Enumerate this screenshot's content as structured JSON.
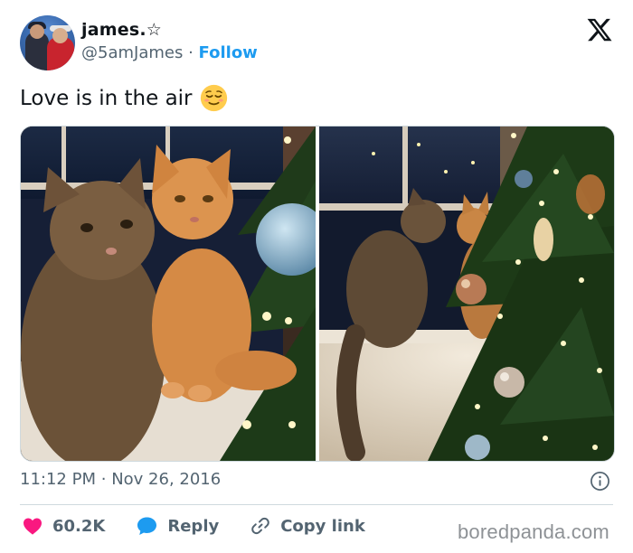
{
  "author": {
    "display_name": "james.☆",
    "handle": "@5amJames",
    "separator": "·",
    "follow_label": "Follow"
  },
  "tweet": {
    "text": "Love is in the air",
    "emoji": "relieved-face-emoji"
  },
  "media": {
    "photos": [
      {
        "subject": "two cats sitting on window sill next to christmas tree"
      },
      {
        "subject": "cat looking at another cat through christmas tree"
      }
    ]
  },
  "meta": {
    "time": "11:12 PM",
    "separator": "·",
    "date": "Nov 26, 2016"
  },
  "actions": {
    "like_count": "60.2K",
    "reply_label": "Reply",
    "copy_label": "Copy link"
  },
  "watermark": "boredpanda.com",
  "colors": {
    "accent": "#1d9bf0",
    "like": "#f91880",
    "secondary_text": "#536471",
    "divider": "#cfd9de"
  },
  "icons": [
    "x-logo-icon",
    "info-icon",
    "heart-icon",
    "reply-bubble-icon",
    "link-icon"
  ]
}
